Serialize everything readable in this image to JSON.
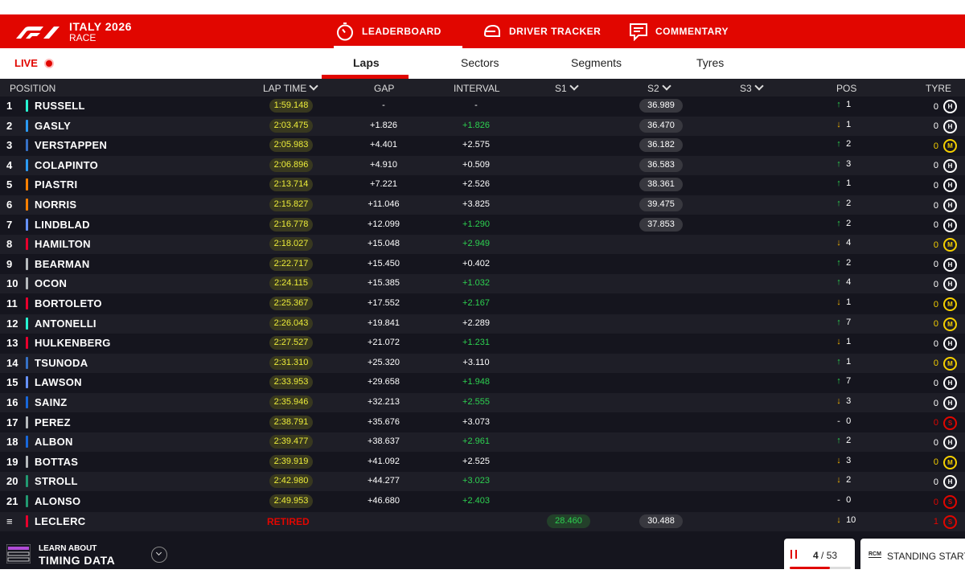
{
  "header": {
    "title": "ITALY 2026",
    "subtitle": "RACE",
    "nav": [
      {
        "label": "LEADERBOARD",
        "icon": "stopwatch-icon"
      },
      {
        "label": "DRIVER TRACKER",
        "icon": "helmet-icon"
      },
      {
        "label": "COMMENTARY",
        "icon": "chat-icon"
      }
    ]
  },
  "subnav": {
    "live_label": "LIVE",
    "tabs": [
      "Laps",
      "Sectors",
      "Segments",
      "Tyres"
    ]
  },
  "table": {
    "columns": [
      "POSITION",
      "LAP TIME",
      "GAP",
      "INTERVAL",
      "S1",
      "S2",
      "S3",
      "POS",
      "TYRE"
    ],
    "rows": [
      {
        "pos": "1",
        "name": "RUSSELL",
        "team_color": "#27f4d2",
        "lap": "1:59.148",
        "gap": "-",
        "interval": "-",
        "interval_green": false,
        "s1": "",
        "s2": "36.989",
        "dir": "up",
        "poschg": "1",
        "tyre_age": "0",
        "tyre": "H",
        "tyre_color": "#ffffff"
      },
      {
        "pos": "2",
        "name": "GASLY",
        "team_color": "#2b9bf4",
        "lap": "2:03.475",
        "gap": "+1.826",
        "interval": "+1.826",
        "interval_green": true,
        "s1": "",
        "s2": "36.470",
        "dir": "down",
        "poschg": "1",
        "tyre_age": "0",
        "tyre": "H",
        "tyre_color": "#ffffff"
      },
      {
        "pos": "3",
        "name": "VERSTAPPEN",
        "team_color": "#3671c6",
        "lap": "2:05.983",
        "gap": "+4.401",
        "interval": "+2.575",
        "interval_green": false,
        "s1": "",
        "s2": "36.182",
        "dir": "up",
        "poschg": "2",
        "tyre_age": "0",
        "tyre": "M",
        "tyre_color": "#f5d000"
      },
      {
        "pos": "4",
        "name": "COLAPINTO",
        "team_color": "#2b9bf4",
        "lap": "2:06.896",
        "gap": "+4.910",
        "interval": "+0.509",
        "interval_green": false,
        "s1": "",
        "s2": "36.583",
        "dir": "up",
        "poschg": "3",
        "tyre_age": "0",
        "tyre": "H",
        "tyre_color": "#ffffff"
      },
      {
        "pos": "5",
        "name": "PIASTRI",
        "team_color": "#ff8000",
        "lap": "2:13.714",
        "gap": "+7.221",
        "interval": "+2.526",
        "interval_green": false,
        "s1": "",
        "s2": "38.361",
        "dir": "up",
        "poschg": "1",
        "tyre_age": "0",
        "tyre": "H",
        "tyre_color": "#ffffff"
      },
      {
        "pos": "6",
        "name": "NORRIS",
        "team_color": "#ff8000",
        "lap": "2:15.827",
        "gap": "+11.046",
        "interval": "+3.825",
        "interval_green": false,
        "s1": "",
        "s2": "39.475",
        "dir": "up",
        "poschg": "2",
        "tyre_age": "0",
        "tyre": "H",
        "tyre_color": "#ffffff"
      },
      {
        "pos": "7",
        "name": "LINDBLAD",
        "team_color": "#6692ff",
        "lap": "2:16.778",
        "gap": "+12.099",
        "interval": "+1.290",
        "interval_green": true,
        "s1": "",
        "s2": "37.853",
        "dir": "up",
        "poschg": "2",
        "tyre_age": "0",
        "tyre": "H",
        "tyre_color": "#ffffff"
      },
      {
        "pos": "8",
        "name": "HAMILTON",
        "team_color": "#e8002d",
        "lap": "2:18.027",
        "gap": "+15.048",
        "interval": "+2.949",
        "interval_green": true,
        "s1": "",
        "s2": "",
        "dir": "down",
        "poschg": "4",
        "tyre_age": "0",
        "tyre": "M",
        "tyre_color": "#f5d000"
      },
      {
        "pos": "9",
        "name": "BEARMAN",
        "team_color": "#b6babd",
        "lap": "2:22.717",
        "gap": "+15.450",
        "interval": "+0.402",
        "interval_green": false,
        "s1": "",
        "s2": "",
        "dir": "up",
        "poschg": "2",
        "tyre_age": "0",
        "tyre": "H",
        "tyre_color": "#ffffff"
      },
      {
        "pos": "10",
        "name": "OCON",
        "team_color": "#b6babd",
        "lap": "2:24.115",
        "gap": "+15.385",
        "interval": "+1.032",
        "interval_green": true,
        "s1": "",
        "s2": "",
        "dir": "up",
        "poschg": "4",
        "tyre_age": "0",
        "tyre": "H",
        "tyre_color": "#ffffff"
      },
      {
        "pos": "11",
        "name": "BORTOLETO",
        "team_color": "#e8002d",
        "lap": "2:25.367",
        "gap": "+17.552",
        "interval": "+2.167",
        "interval_green": true,
        "s1": "",
        "s2": "",
        "dir": "down",
        "poschg": "1",
        "tyre_age": "0",
        "tyre": "M",
        "tyre_color": "#f5d000"
      },
      {
        "pos": "12",
        "name": "ANTONELLI",
        "team_color": "#27f4d2",
        "lap": "2:26.043",
        "gap": "+19.841",
        "interval": "+2.289",
        "interval_green": false,
        "s1": "",
        "s2": "",
        "dir": "up",
        "poschg": "7",
        "tyre_age": "0",
        "tyre": "M",
        "tyre_color": "#f5d000"
      },
      {
        "pos": "13",
        "name": "HULKENBERG",
        "team_color": "#e8002d",
        "lap": "2:27.527",
        "gap": "+21.072",
        "interval": "+1.231",
        "interval_green": true,
        "s1": "",
        "s2": "",
        "dir": "down",
        "poschg": "1",
        "tyre_age": "0",
        "tyre": "H",
        "tyre_color": "#ffffff"
      },
      {
        "pos": "14",
        "name": "TSUNODA",
        "team_color": "#3671c6",
        "lap": "2:31.310",
        "gap": "+25.320",
        "interval": "+3.110",
        "interval_green": false,
        "s1": "",
        "s2": "",
        "dir": "up",
        "poschg": "1",
        "tyre_age": "0",
        "tyre": "M",
        "tyre_color": "#f5d000"
      },
      {
        "pos": "15",
        "name": "LAWSON",
        "team_color": "#6692ff",
        "lap": "2:33.953",
        "gap": "+29.658",
        "interval": "+1.948",
        "interval_green": true,
        "s1": "",
        "s2": "",
        "dir": "up",
        "poschg": "7",
        "tyre_age": "0",
        "tyre": "H",
        "tyre_color": "#ffffff"
      },
      {
        "pos": "16",
        "name": "SAINZ",
        "team_color": "#1868db",
        "lap": "2:35.946",
        "gap": "+32.213",
        "interval": "+2.555",
        "interval_green": true,
        "s1": "",
        "s2": "",
        "dir": "down",
        "poschg": "3",
        "tyre_age": "0",
        "tyre": "H",
        "tyre_color": "#ffffff"
      },
      {
        "pos": "17",
        "name": "PEREZ",
        "team_color": "#b6babd",
        "lap": "2:38.791",
        "gap": "+35.676",
        "interval": "+3.073",
        "interval_green": false,
        "s1": "",
        "s2": "",
        "dir": "same",
        "poschg": "0",
        "tyre_age": "0",
        "tyre": "S",
        "tyre_color": "#e10600"
      },
      {
        "pos": "18",
        "name": "ALBON",
        "team_color": "#1868db",
        "lap": "2:39.477",
        "gap": "+38.637",
        "interval": "+2.961",
        "interval_green": true,
        "s1": "",
        "s2": "",
        "dir": "up",
        "poschg": "2",
        "tyre_age": "0",
        "tyre": "H",
        "tyre_color": "#ffffff"
      },
      {
        "pos": "19",
        "name": "BOTTAS",
        "team_color": "#b6babd",
        "lap": "2:39.919",
        "gap": "+41.092",
        "interval": "+2.525",
        "interval_green": false,
        "s1": "",
        "s2": "",
        "dir": "down",
        "poschg": "3",
        "tyre_age": "0",
        "tyre": "M",
        "tyre_color": "#f5d000"
      },
      {
        "pos": "20",
        "name": "STROLL",
        "team_color": "#229971",
        "lap": "2:42.980",
        "gap": "+44.277",
        "interval": "+3.023",
        "interval_green": true,
        "s1": "",
        "s2": "",
        "dir": "down",
        "poschg": "2",
        "tyre_age": "0",
        "tyre": "H",
        "tyre_color": "#ffffff"
      },
      {
        "pos": "21",
        "name": "ALONSO",
        "team_color": "#229971",
        "lap": "2:49.953",
        "gap": "+46.680",
        "interval": "+2.403",
        "interval_green": true,
        "s1": "",
        "s2": "",
        "dir": "same",
        "poschg": "0",
        "tyre_age": "0",
        "tyre": "S",
        "tyre_color": "#e10600"
      },
      {
        "pos": "≡",
        "name": "LECLERC",
        "team_color": "#e8002d",
        "lap": "RETIRED",
        "retired": true,
        "gap": "",
        "interval": "",
        "interval_green": false,
        "s1": "28.460",
        "s2": "30.488",
        "dir": "down",
        "poschg": "10",
        "tyre_age": "1",
        "tyre": "S",
        "tyre_color": "#e10600"
      }
    ]
  },
  "footer": {
    "learn_line1": "LEARN ABOUT",
    "learn_line2": "TIMING DATA",
    "lap_current": "4",
    "lap_sep": "/",
    "lap_total": "53",
    "lap_progress": 0.66,
    "rcm_label": "RCM",
    "rcm_text": "STANDING START"
  },
  "colors": {
    "accent": "#e10600",
    "background": "#15151e",
    "green": "#2dd150",
    "lap_yellow": "#ecec3a"
  }
}
